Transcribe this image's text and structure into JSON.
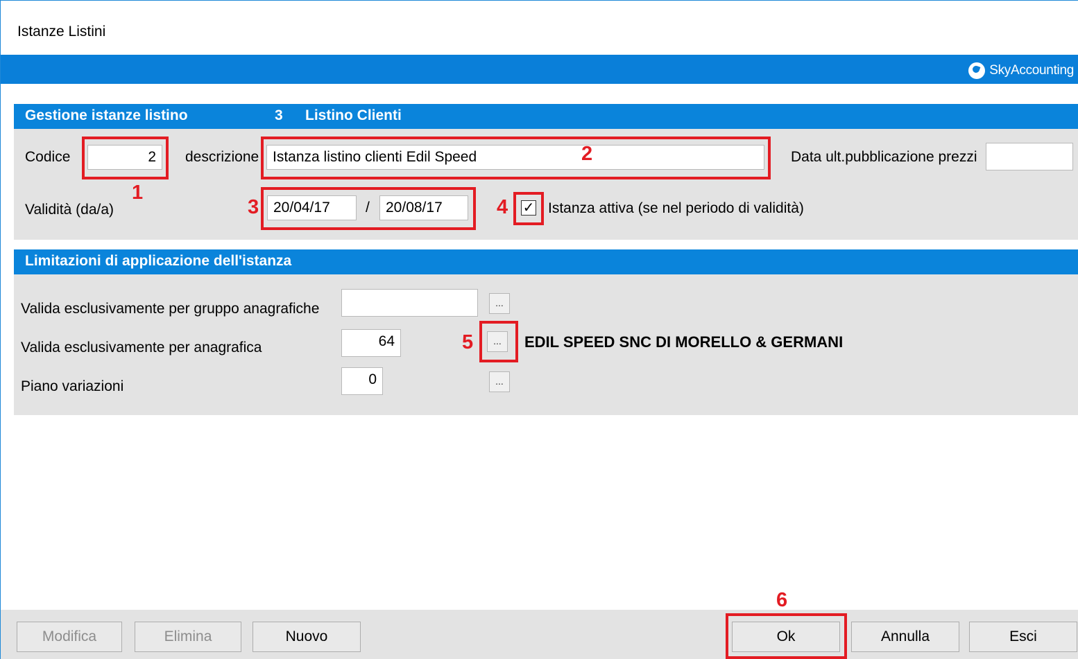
{
  "window": {
    "title": "Istanze Listini",
    "brand": "SkyAccounting"
  },
  "section1": {
    "title": "Gestione istanze listino",
    "listino_num": "3",
    "listino_name": "Listino Clienti",
    "codice_label": "Codice",
    "codice_value": "2",
    "descrizione_label": "descrizione",
    "descrizione_value": "Istanza listino clienti Edil Speed",
    "data_pub_label": "Data ult.pubblicazione prezzi",
    "data_pub_value": "",
    "validita_label": "Validità (da/a)",
    "validita_from": "20/04/17",
    "validita_sep": "/",
    "validita_to": "20/08/17",
    "attiva_checked": true,
    "attiva_check_glyph": "✓",
    "attiva_label": "Istanza attiva (se nel periodo di validità)"
  },
  "section2": {
    "title": "Limitazioni di applicazione dell'istanza",
    "gruppo_label": "Valida esclusivamente per gruppo anagrafiche",
    "gruppo_value": "",
    "anagrafica_label": "Valida esclusivamente per anagrafica",
    "anagrafica_value": "64",
    "anagrafica_name": "EDIL SPEED SNC DI MORELLO & GERMANI",
    "piano_label": "Piano variazioni",
    "piano_value": "0",
    "ellipsis": "..."
  },
  "annotations": {
    "n1": "1",
    "n2": "2",
    "n3": "3",
    "n4": "4",
    "n5": "5",
    "n6": "6"
  },
  "footer": {
    "modifica": "Modifica",
    "elimina": "Elimina",
    "nuovo": "Nuovo",
    "ok": "Ok",
    "annulla": "Annulla",
    "esci": "Esci"
  },
  "colors": {
    "accent": "#0a84db",
    "annotation": "#e31c23",
    "panel": "#e3e3e3"
  }
}
